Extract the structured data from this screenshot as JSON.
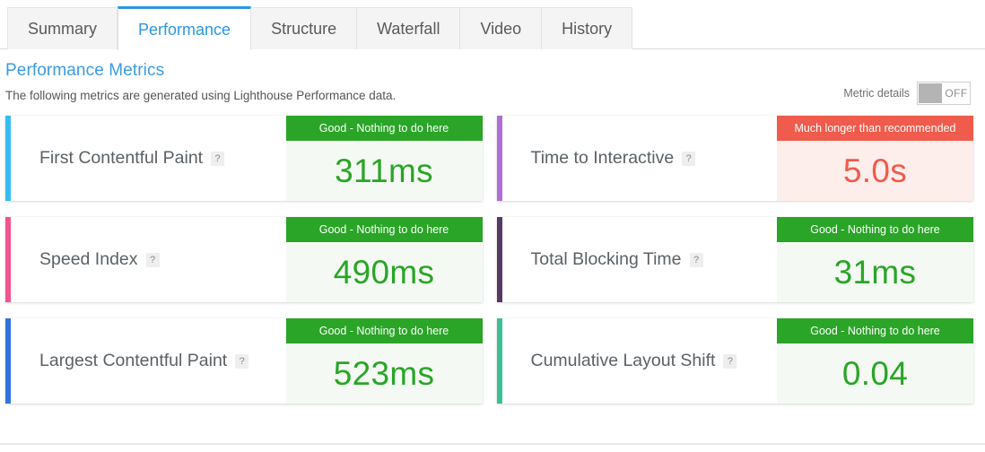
{
  "tabs": [
    {
      "label": "Summary",
      "active": false
    },
    {
      "label": "Performance",
      "active": true
    },
    {
      "label": "Structure",
      "active": false
    },
    {
      "label": "Waterfall",
      "active": false
    },
    {
      "label": "Video",
      "active": false
    },
    {
      "label": "History",
      "active": false
    }
  ],
  "header": {
    "title": "Performance Metrics",
    "subtitle": "The following metrics are generated using Lighthouse Performance data."
  },
  "metric_details": {
    "label": "Metric details",
    "state": "OFF",
    "enabled": false
  },
  "help_icon_glyph": "?",
  "colors": {
    "active_tab": "#2b97e2",
    "title": "#3d9be0",
    "good": "#2aa527",
    "good_bg": "#f4faf3",
    "bad": "#ef5b4c",
    "bad_bg": "#fdeeeb"
  },
  "metrics": [
    {
      "name": "First Contentful Paint",
      "accent": "#35bdf2",
      "status": "good",
      "badge": "Good - Nothing to do here",
      "value": "311ms"
    },
    {
      "name": "Time to Interactive",
      "accent": "#b06fd6",
      "status": "bad",
      "badge": "Much longer than recommended",
      "value": "5.0s"
    },
    {
      "name": "Speed Index",
      "accent": "#f4558f",
      "status": "good",
      "badge": "Good - Nothing to do here",
      "value": "490ms"
    },
    {
      "name": "Total Blocking Time",
      "accent": "#573963",
      "status": "good",
      "badge": "Good - Nothing to do here",
      "value": "31ms"
    },
    {
      "name": "Largest Contentful Paint",
      "accent": "#3274dd",
      "status": "good",
      "badge": "Good - Nothing to do here",
      "value": "523ms"
    },
    {
      "name": "Cumulative Layout Shift",
      "accent": "#3bbf95",
      "status": "good",
      "badge": "Good - Nothing to do here",
      "value": "0.04"
    }
  ]
}
